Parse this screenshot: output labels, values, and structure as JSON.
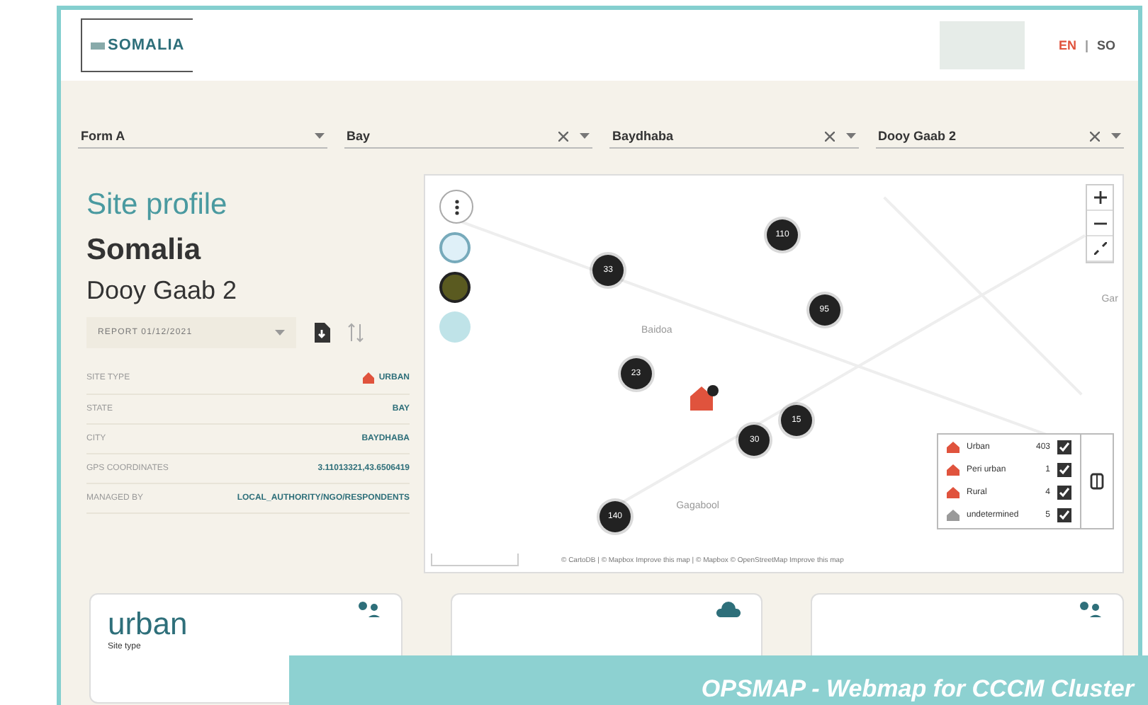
{
  "header": {
    "logo_text": "SOMALIA",
    "languages": [
      {
        "code": "EN",
        "selected": true
      },
      {
        "code": "SO",
        "selected": false
      }
    ],
    "separator": "|"
  },
  "filters": [
    {
      "value": "Form A",
      "clearable": false
    },
    {
      "value": "Bay",
      "clearable": true
    },
    {
      "value": "Baydhaba",
      "clearable": true
    },
    {
      "value": "Dooy Gaab 2",
      "clearable": true
    }
  ],
  "profile": {
    "title": "Site profile",
    "country": "Somalia",
    "site": "Dooy Gaab 2",
    "report": "REPORT 01/12/2021",
    "rows": [
      {
        "label": "SITE TYPE",
        "value": "URBAN",
        "icon": true
      },
      {
        "label": "STATE",
        "value": "BAY",
        "icon": false
      },
      {
        "label": "CITY",
        "value": "BAYDHABA",
        "icon": false
      },
      {
        "label": "GPS COORDINATES",
        "value": "3.11013321,43.6506419",
        "icon": false
      },
      {
        "label": "MANAGED BY",
        "value": "LOCAL_AUTHORITY/NGO/RESPONDENTS",
        "icon": false
      }
    ]
  },
  "map": {
    "clusters": [
      "33",
      "110",
      "95",
      "23",
      "15",
      "30",
      "140"
    ],
    "places": [
      "Baidoa",
      "Gagabool",
      "Gar"
    ],
    "legend": [
      {
        "label": "Urban",
        "count": "403",
        "checked": true,
        "color": "#e0533d"
      },
      {
        "label": "Peri urban",
        "count": "1",
        "checked": true,
        "color": "#e0533d"
      },
      {
        "label": "Rural",
        "count": "4",
        "checked": true,
        "color": "#e0533d"
      },
      {
        "label": "undetermined",
        "count": "5",
        "checked": true,
        "color": "#9a9a9a"
      }
    ],
    "attribution": "© CartoDB | © Mapbox Improve this map | © Mapbox © OpenStreetMap Improve this map"
  },
  "cards": [
    {
      "kind": "people",
      "title": "urban",
      "subtitle": "Site type"
    },
    {
      "kind": "cloud"
    },
    {
      "kind": "people"
    }
  ],
  "banner": "OPSMAP - Webmap for CCCM Cluster"
}
